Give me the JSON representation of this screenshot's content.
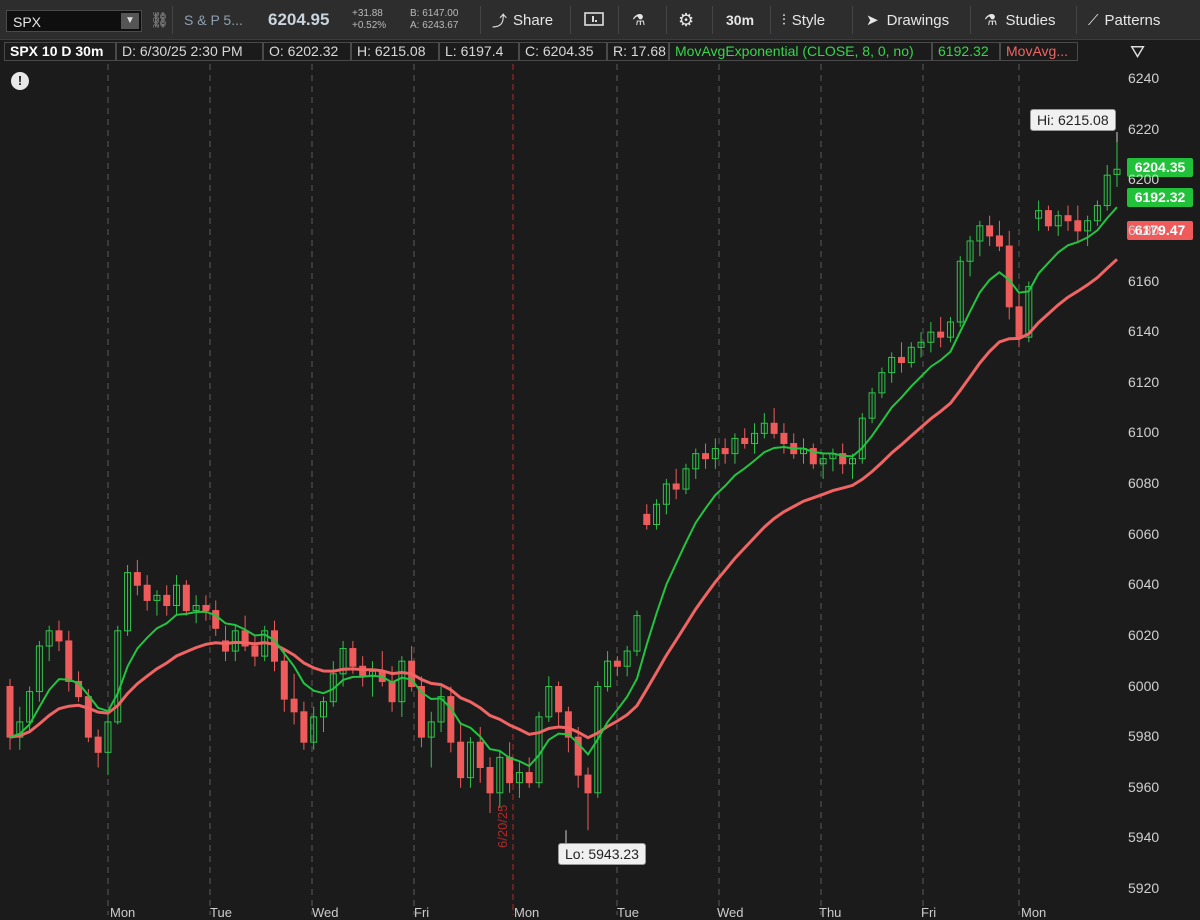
{
  "toolbar": {
    "symbol": "SPX",
    "description": "S & P 5...",
    "last": "6204.95",
    "change": "+31.88",
    "change_pct": "+0.52%",
    "bid": "B: 6147.00",
    "ask": "A: 6243.67",
    "share": "Share",
    "timeframe": "30m",
    "style": "Style",
    "drawings": "Drawings",
    "studies": "Studies",
    "patterns": "Patterns"
  },
  "info": {
    "title": "SPX 10 D 30m",
    "date": "D: 6/30/25 2:30 PM",
    "open": "O: 6202.32",
    "high": "H: 6215.08",
    "low": "L: 6197.4",
    "close": "C: 6204.35",
    "range": "R: 17.68",
    "study1": "MovAvgExponential (CLOSE, 8, 0, no)",
    "study1_value": "6192.32",
    "study2": "MovAvg..."
  },
  "axis": {
    "ticks": [
      6240,
      6220,
      6200,
      6180,
      6160,
      6140,
      6120,
      6100,
      6080,
      6060,
      6040,
      6020,
      6000,
      5980,
      5960,
      5940,
      5920
    ],
    "last_price_label": "6204.35",
    "ema_label": "6192.32",
    "ma_label": "6179.47"
  },
  "callouts": {
    "hi": "Hi: 6215.08",
    "lo": "Lo: 5943.23",
    "marker_date": "6/20/25"
  },
  "days": [
    "Mon",
    "Tue",
    "Wed",
    "Fri",
    "Mon",
    "Tue",
    "Wed",
    "Thu",
    "Fri",
    "Mon"
  ],
  "colors": {
    "up": "#2fc44a",
    "down": "#ef5b5b",
    "ema": "#22c440",
    "ma": "#f06464",
    "marker": "#b02a2a"
  },
  "chart_data": {
    "type": "candlestick",
    "ylim": [
      5915,
      6250
    ],
    "ohlc": [
      [
        6000,
        6003,
        5975,
        5980
      ],
      [
        5980,
        5992,
        5975,
        5986
      ],
      [
        5986,
        6000,
        5982,
        5998
      ],
      [
        5998,
        6018,
        5994,
        6016
      ],
      [
        6016,
        6024,
        6010,
        6022
      ],
      [
        6022,
        6026,
        6014,
        6018
      ],
      [
        6018,
        6022,
        5998,
        6002
      ],
      [
        6002,
        6006,
        5994,
        5996
      ],
      [
        5996,
        5999,
        5978,
        5980
      ],
      [
        5980,
        5983,
        5968,
        5974
      ],
      [
        5974,
        5990,
        5965,
        5986
      ],
      [
        5986,
        6024,
        5985,
        6022
      ],
      [
        6022,
        6048,
        6020,
        6045
      ],
      [
        6045,
        6050,
        6036,
        6040
      ],
      [
        6040,
        6044,
        6030,
        6034
      ],
      [
        6034,
        6038,
        6028,
        6036
      ],
      [
        6036,
        6040,
        6028,
        6032
      ],
      [
        6032,
        6044,
        6028,
        6040
      ],
      [
        6040,
        6042,
        6028,
        6030
      ],
      [
        6030,
        6036,
        6025,
        6032
      ],
      [
        6032,
        6036,
        6026,
        6030
      ],
      [
        6030,
        6034,
        6020,
        6023
      ],
      [
        6018,
        6024,
        6010,
        6014
      ],
      [
        6014,
        6024,
        6010,
        6022
      ],
      [
        6022,
        6028,
        6014,
        6016
      ],
      [
        6016,
        6020,
        6008,
        6012
      ],
      [
        6012,
        6024,
        6010,
        6022
      ],
      [
        6022,
        6026,
        6006,
        6010
      ],
      [
        6010,
        6014,
        5990,
        5995
      ],
      [
        5995,
        6005,
        5985,
        5990
      ],
      [
        5990,
        5994,
        5975,
        5978
      ],
      [
        5978,
        5992,
        5975,
        5988
      ],
      [
        5988,
        5996,
        5982,
        5994
      ],
      [
        5994,
        6010,
        5992,
        6005
      ],
      [
        6005,
        6018,
        6000,
        6015
      ],
      [
        6015,
        6018,
        6005,
        6008
      ],
      [
        6008,
        6012,
        6000,
        6004
      ],
      [
        6004,
        6010,
        5996,
        6006
      ],
      [
        6006,
        6014,
        6000,
        6002
      ],
      [
        6002,
        6008,
        5990,
        5994
      ],
      [
        5994,
        6012,
        5988,
        6010
      ],
      [
        6010,
        6016,
        5998,
        6000
      ],
      [
        6000,
        6004,
        5976,
        5980
      ],
      [
        5980,
        5990,
        5968,
        5986
      ],
      [
        5986,
        6000,
        5982,
        5996
      ],
      [
        5996,
        6000,
        5974,
        5978
      ],
      [
        5978,
        5986,
        5960,
        5964
      ],
      [
        5964,
        5980,
        5960,
        5978
      ],
      [
        5978,
        5984,
        5962,
        5968
      ],
      [
        5968,
        5972,
        5950,
        5958
      ],
      [
        5958,
        5975,
        5952,
        5972
      ],
      [
        5972,
        5978,
        5958,
        5962
      ],
      [
        5962,
        5970,
        5956,
        5966
      ],
      [
        5966,
        5972,
        5960,
        5962
      ],
      [
        5962,
        5990,
        5960,
        5988
      ],
      [
        5988,
        6004,
        5986,
        6000
      ],
      [
        6000,
        6002,
        5984,
        5990
      ],
      [
        5990,
        5992,
        5974,
        5980
      ],
      [
        5980,
        5984,
        5960,
        5965
      ],
      [
        5965,
        5968,
        5943.23,
        5958
      ],
      [
        5958,
        6002,
        5956,
        6000
      ],
      [
        6000,
        6014,
        5998,
        6010
      ],
      [
        6010,
        6012,
        6004,
        6008
      ],
      [
        6008,
        6016,
        6004,
        6014
      ],
      [
        6014,
        6030,
        6012,
        6028
      ],
      [
        6068,
        6072,
        6062,
        6064
      ],
      [
        6064,
        6074,
        6062,
        6072
      ],
      [
        6072,
        6082,
        6068,
        6080
      ],
      [
        6080,
        6086,
        6074,
        6078
      ],
      [
        6078,
        6088,
        6076,
        6086
      ],
      [
        6086,
        6094,
        6082,
        6092
      ],
      [
        6092,
        6096,
        6086,
        6090
      ],
      [
        6090,
        6098,
        6086,
        6094
      ],
      [
        6094,
        6098,
        6088,
        6092
      ],
      [
        6092,
        6100,
        6088,
        6098
      ],
      [
        6098,
        6102,
        6094,
        6096
      ],
      [
        6096,
        6104,
        6092,
        6100
      ],
      [
        6100,
        6108,
        6098,
        6104
      ],
      [
        6104,
        6110,
        6098,
        6100
      ],
      [
        6100,
        6104,
        6092,
        6096
      ],
      [
        6096,
        6100,
        6090,
        6092
      ],
      [
        6092,
        6098,
        6088,
        6094
      ],
      [
        6094,
        6096,
        6086,
        6088
      ],
      [
        6088,
        6092,
        6082,
        6090
      ],
      [
        6090,
        6094,
        6085,
        6092
      ],
      [
        6092,
        6096,
        6084,
        6088
      ],
      [
        6088,
        6092,
        6082,
        6090
      ],
      [
        6090,
        6108,
        6088,
        6106
      ],
      [
        6106,
        6118,
        6104,
        6116
      ],
      [
        6116,
        6126,
        6114,
        6124
      ],
      [
        6124,
        6132,
        6120,
        6130
      ],
      [
        6130,
        6136,
        6124,
        6128
      ],
      [
        6128,
        6136,
        6126,
        6134
      ],
      [
        6134,
        6140,
        6130,
        6136
      ],
      [
        6136,
        6144,
        6132,
        6140
      ],
      [
        6140,
        6146,
        6134,
        6138
      ],
      [
        6138,
        6146,
        6136,
        6144
      ],
      [
        6144,
        6170,
        6142,
        6168
      ],
      [
        6168,
        6178,
        6162,
        6176
      ],
      [
        6176,
        6184,
        6170,
        6182
      ],
      [
        6182,
        6186,
        6174,
        6178
      ],
      [
        6178,
        6184,
        6172,
        6174
      ],
      [
        6174,
        6180,
        6145,
        6150
      ],
      [
        6150,
        6156,
        6134,
        6138
      ],
      [
        6138,
        6160,
        6136,
        6158
      ],
      [
        6185,
        6192,
        6180,
        6188
      ],
      [
        6188,
        6190,
        6180,
        6182
      ],
      [
        6182,
        6188,
        6178,
        6186
      ],
      [
        6186,
        6190,
        6180,
        6184
      ],
      [
        6184,
        6190,
        6176,
        6180
      ],
      [
        6180,
        6186,
        6174,
        6184
      ],
      [
        6184,
        6192,
        6182,
        6190
      ],
      [
        6190,
        6206,
        6188,
        6202
      ],
      [
        6202.32,
        6215.08,
        6197.4,
        6204.35
      ]
    ],
    "ema8": [
      6020,
      6018,
      6016,
      6014,
      6013,
      6012,
      6010,
      6008,
      6006,
      6004,
      6004
    ],
    "ma_last": 6179.47,
    "ema_last": 6192.32
  }
}
